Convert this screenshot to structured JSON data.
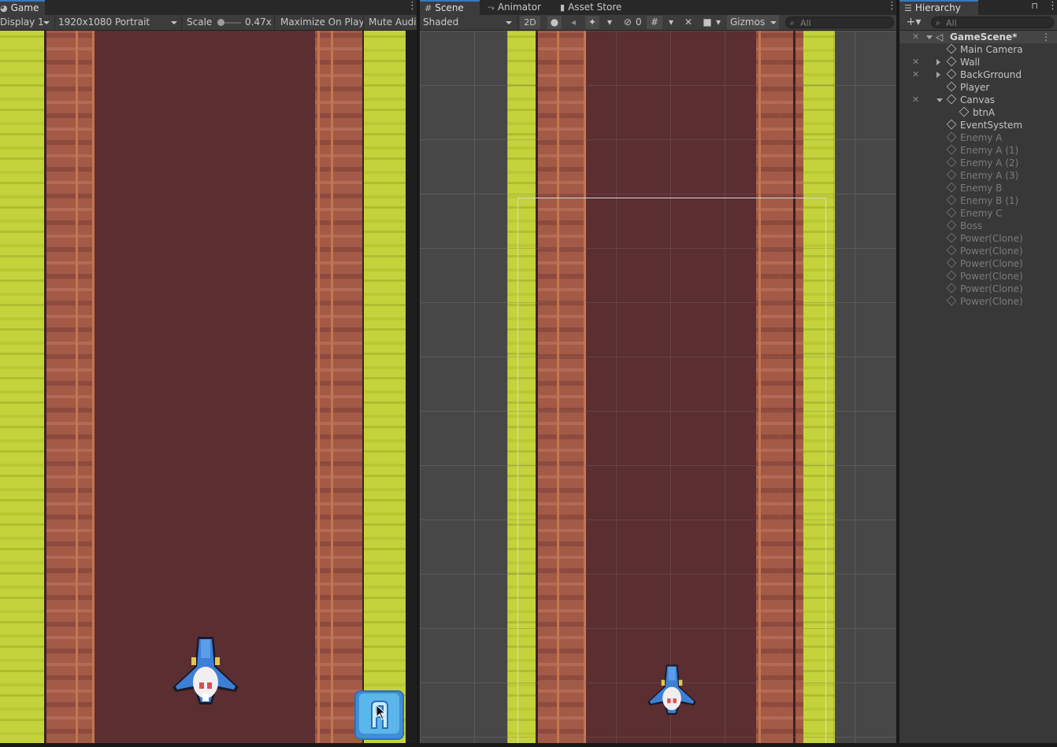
{
  "game": {
    "tab_label": "Game",
    "display": "Display 1",
    "resolution": "1920x1080 Portrait",
    "scale_label": "Scale",
    "scale_value": "0.47x",
    "maximize_label": "Maximize On Play",
    "mute_label": "Mute Audio"
  },
  "scene": {
    "tabs": [
      {
        "label": "Scene",
        "icon": "grid-icon"
      },
      {
        "label": "Animator",
        "icon": "animator-icon"
      },
      {
        "label": "Asset Store",
        "icon": "store-icon"
      }
    ],
    "draw_mode": "Shaded",
    "mode_2d": "2D",
    "hidden_count": "0",
    "gizmos_label": "Gizmos",
    "search_placeholder": "All"
  },
  "hierarchy": {
    "tab_label": "Hierarchy",
    "search_placeholder": "All",
    "scene_name": "GameScene*",
    "items": [
      {
        "label": "Main Camera",
        "depth": 1,
        "active": true,
        "expander": "none"
      },
      {
        "label": "Wall",
        "depth": 1,
        "active": true,
        "expander": "collapsed",
        "hidden": true
      },
      {
        "label": "BackGrround",
        "depth": 1,
        "active": true,
        "expander": "collapsed",
        "hidden": true
      },
      {
        "label": "Player",
        "depth": 1,
        "active": true,
        "expander": "none"
      },
      {
        "label": "Canvas",
        "depth": 1,
        "active": true,
        "expander": "expanded",
        "hidden": true
      },
      {
        "label": "btnA",
        "depth": 2,
        "active": true,
        "expander": "none"
      },
      {
        "label": "EventSystem",
        "depth": 1,
        "active": true,
        "expander": "none"
      },
      {
        "label": "Enemy A",
        "depth": 1,
        "active": false,
        "expander": "none"
      },
      {
        "label": "Enemy A (1)",
        "depth": 1,
        "active": false,
        "expander": "none"
      },
      {
        "label": "Enemy A (2)",
        "depth": 1,
        "active": false,
        "expander": "none"
      },
      {
        "label": "Enemy A (3)",
        "depth": 1,
        "active": false,
        "expander": "none"
      },
      {
        "label": "Enemy B",
        "depth": 1,
        "active": false,
        "expander": "none"
      },
      {
        "label": "Enemy B (1)",
        "depth": 1,
        "active": false,
        "expander": "none"
      },
      {
        "label": "Enemy C",
        "depth": 1,
        "active": false,
        "expander": "none"
      },
      {
        "label": "Boss",
        "depth": 1,
        "active": false,
        "expander": "none"
      },
      {
        "label": "Power(Clone)",
        "depth": 1,
        "active": false,
        "expander": "none"
      },
      {
        "label": "Power(Clone)",
        "depth": 1,
        "active": false,
        "expander": "none"
      },
      {
        "label": "Power(Clone)",
        "depth": 1,
        "active": false,
        "expander": "none"
      },
      {
        "label": "Power(Clone)",
        "depth": 1,
        "active": false,
        "expander": "none"
      },
      {
        "label": "Power(Clone)",
        "depth": 1,
        "active": false,
        "expander": "none"
      },
      {
        "label": "Power(Clone)",
        "depth": 1,
        "active": false,
        "expander": "none"
      }
    ]
  },
  "colors": {
    "accent": "#3a79bb",
    "road": "#5b2e31",
    "grass": "#c4d33b",
    "dirt": "#a35a46",
    "ship": "#3d7fd6",
    "button_a": "#5bb6ea"
  }
}
